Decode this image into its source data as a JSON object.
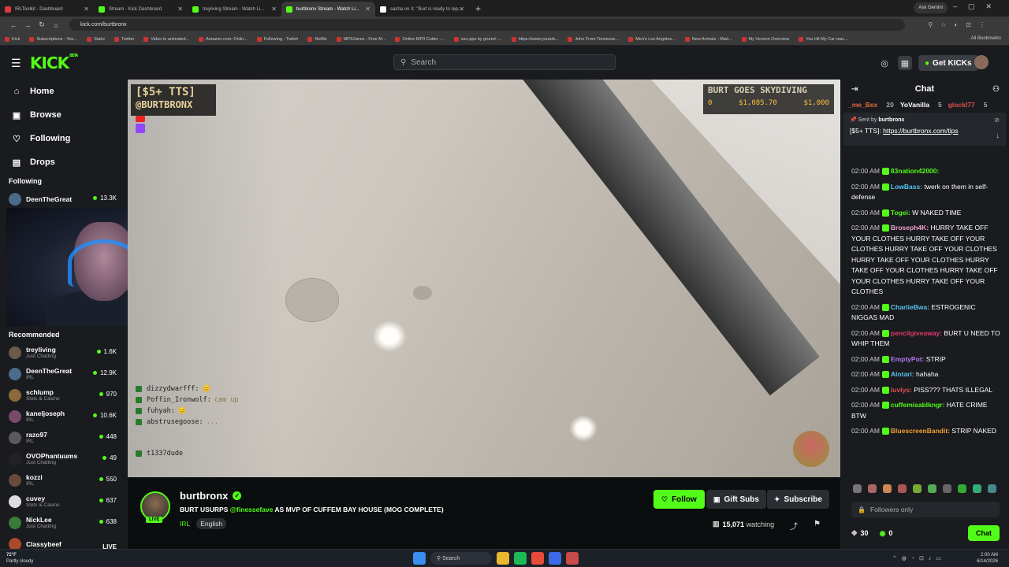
{
  "browser": {
    "tabs": [
      {
        "title": "IRLToolkit - Dashboard",
        "color": "#e03a3a",
        "active": false
      },
      {
        "title": "Stream - Kick Dashboard",
        "color": "#53fc18",
        "active": false
      },
      {
        "title": "treyliving Stream - Watch Li...",
        "color": "#53fc18",
        "active": false
      },
      {
        "title": "burtbronx Stream - Watch Li...",
        "color": "#53fc18",
        "active": true
      },
      {
        "title": "sasha on X: \"Burt is ready to rep...",
        "color": "#ffffff",
        "active": false
      }
    ],
    "ask_gemini": "Ask Gemini",
    "url": "kick.com/burtbronx",
    "bookmarks": [
      "Kick",
      "Subscriptions - You...",
      "Stake",
      "Twitter",
      "Video to animated...",
      "Amazon.com: Onlin...",
      "Following - Twitch",
      "Netflix",
      "MP3Juices - Free M...",
      "Online MP3 Cutter -...",
      "osu-pps by grumd -...",
      "https://www.youtub...",
      "John From Tennesse...",
      "Men's Los Angeles...",
      "New Arrivals - Mad...",
      "My Verizon Overview",
      "You Hit My Car reac..."
    ],
    "all_bookmarks": "All Bookmarks"
  },
  "header": {
    "logo": "KICK",
    "logo_sup": "BETA",
    "search_placeholder": "Search",
    "get_kicks": "Get KICKs"
  },
  "sidebar": {
    "nav": [
      {
        "label": "Home",
        "icon": "home-icon",
        "glyph": "⌂"
      },
      {
        "label": "Browse",
        "icon": "browse-icon",
        "glyph": "▣"
      },
      {
        "label": "Following",
        "icon": "heart-icon",
        "glyph": "♡"
      },
      {
        "label": "Drops",
        "icon": "drops-icon",
        "glyph": "▤"
      }
    ],
    "following_label": "Following",
    "following": [
      {
        "name": "DeenTheGreat",
        "count": "13.3K"
      }
    ],
    "recommended_label": "Recommended",
    "recommended": [
      {
        "name": "treyliving",
        "category": "Just Chatting",
        "count": "1.6K",
        "color": "#6b5a4a"
      },
      {
        "name": "DeenTheGreat",
        "category": "IRL",
        "count": "12.9K",
        "color": "#4a6b8a"
      },
      {
        "name": "schlump",
        "category": "Slots & Casino",
        "count": "970",
        "color": "#8a6a3a"
      },
      {
        "name": "kaneljoseph",
        "category": "IRL",
        "count": "10.6K",
        "color": "#7a4a6a"
      },
      {
        "name": "razo97",
        "category": "IRL",
        "count": "448",
        "color": "#5a5a5a"
      },
      {
        "name": "OVOPhantuums",
        "category": "Just Chatting",
        "count": "49",
        "color": "#222222"
      },
      {
        "name": "kozzi",
        "category": "IRL",
        "count": "550",
        "color": "#6a4a3a"
      },
      {
        "name": "cuvey",
        "category": "Slots & Casino",
        "count": "637",
        "color": "#dddddd"
      },
      {
        "name": "NickLee",
        "category": "Just Chatting",
        "count": "638",
        "color": "#3a7a3a"
      },
      {
        "name": "Classybeef",
        "category": "",
        "live": "LIVE",
        "color": "#aa4a2a"
      }
    ]
  },
  "video": {
    "tts_line1": "[$5+ TTS]",
    "tts_line2": "@BURTBRONX",
    "goal_title": "BURT GOES SKYDIVING",
    "goal_current": "$1,085.70",
    "goal_target": "$1,000",
    "goal_left": "0",
    "overlay_chat": [
      {
        "user": "dizzydwarfff",
        "msg": "😊"
      },
      {
        "user": "Poffin_Ironwolf",
        "msg": "cam up"
      },
      {
        "user": "fuhyah",
        "msg": "😊"
      },
      {
        "user": "abstrusegoose",
        "msg": "..."
      }
    ],
    "overlay_last_user": "t1337dude"
  },
  "stream": {
    "name": "burtbronx",
    "live": "LIVE",
    "title_prefix": "BURT USURPS ",
    "title_mention": "@finessefave",
    "title_suffix": " AS MVP OF CUFFEM BAY HOUSE (MOG COMPLETE)",
    "category": "IRL",
    "language": "English",
    "follow": "Follow",
    "gift_subs": "Gift Subs",
    "subscribe": "Subscribe",
    "viewers": "15,071",
    "watching_label": "watching"
  },
  "chat": {
    "title": "Chat",
    "gifters": [
      {
        "name": "_me_Bex",
        "count": "20"
      },
      {
        "name": "YoVanilla",
        "count": "5"
      },
      {
        "name": "glockl77",
        "count": "5"
      }
    ],
    "pinned_sent_by_label": "Sent by",
    "pinned_sender": "burtbronx",
    "pinned_text": "[$5+ TTS]:",
    "pinned_link": "https://burtbronx.com/tips",
    "messages": [
      {
        "time": "02:00 AM",
        "user": "83nation42000:",
        "color": "#53fc18",
        "text": ""
      },
      {
        "time": "02:00 AM",
        "user": "LowBass:",
        "color": "#58c4f0",
        "text": "twerk on them in self-defense"
      },
      {
        "time": "02:00 AM",
        "user": "Togei:",
        "color": "#53fc18",
        "text": "W NAKED TIME"
      },
      {
        "time": "02:00 AM",
        "user": "Broseph4K:",
        "color": "#f0a0c8",
        "text": "HURRY TAKE OFF YOUR CLOTHES HURRY TAKE OFF YOUR CLOTHES HURRY TAKE OFF YOUR CLOTHES HURRY TAKE OFF YOUR CLOTHES HURRY TAKE OFF YOUR CLOTHES HURRY TAKE OFF YOUR CLOTHES HURRY TAKE OFF YOUR CLOTHES"
      },
      {
        "time": "02:00 AM",
        "user": "CharlieBwa:",
        "color": "#58c4f0",
        "text": "ESTROGENIC NIGGAS MAD"
      },
      {
        "time": "02:00 AM",
        "user": "pencilgiveaway:",
        "color": "#e03a6a",
        "text": "BURT U NEED TO WHIP THEM"
      },
      {
        "time": "02:00 AM",
        "user": "EmptyPot:",
        "color": "#b07af0",
        "text": "STRIP"
      },
      {
        "time": "02:00 AM",
        "user": "Alotari:",
        "color": "#58c4f0",
        "text": "hahaha"
      },
      {
        "time": "02:00 AM",
        "user": "luvlys:",
        "color": "#e05050",
        "text": "PISS??? THATS ILLEGAL"
      },
      {
        "time": "02:00 AM",
        "user": "cuffemisablkngr:",
        "color": "#53fc18",
        "text": "HATE CRIME BTW"
      },
      {
        "time": "02:00 AM",
        "user": "BluescreenBandit:",
        "color": "#f0a030",
        "text": "STRIP NAKED"
      }
    ],
    "input_placeholder": "Followers only",
    "points": "30",
    "kicks": "0",
    "chat_button": "Chat"
  },
  "taskbar": {
    "temp": "72°F",
    "weather": "Partly cloudy",
    "search": "Search",
    "time": "2:00 AM",
    "date": "6/14/2026"
  }
}
